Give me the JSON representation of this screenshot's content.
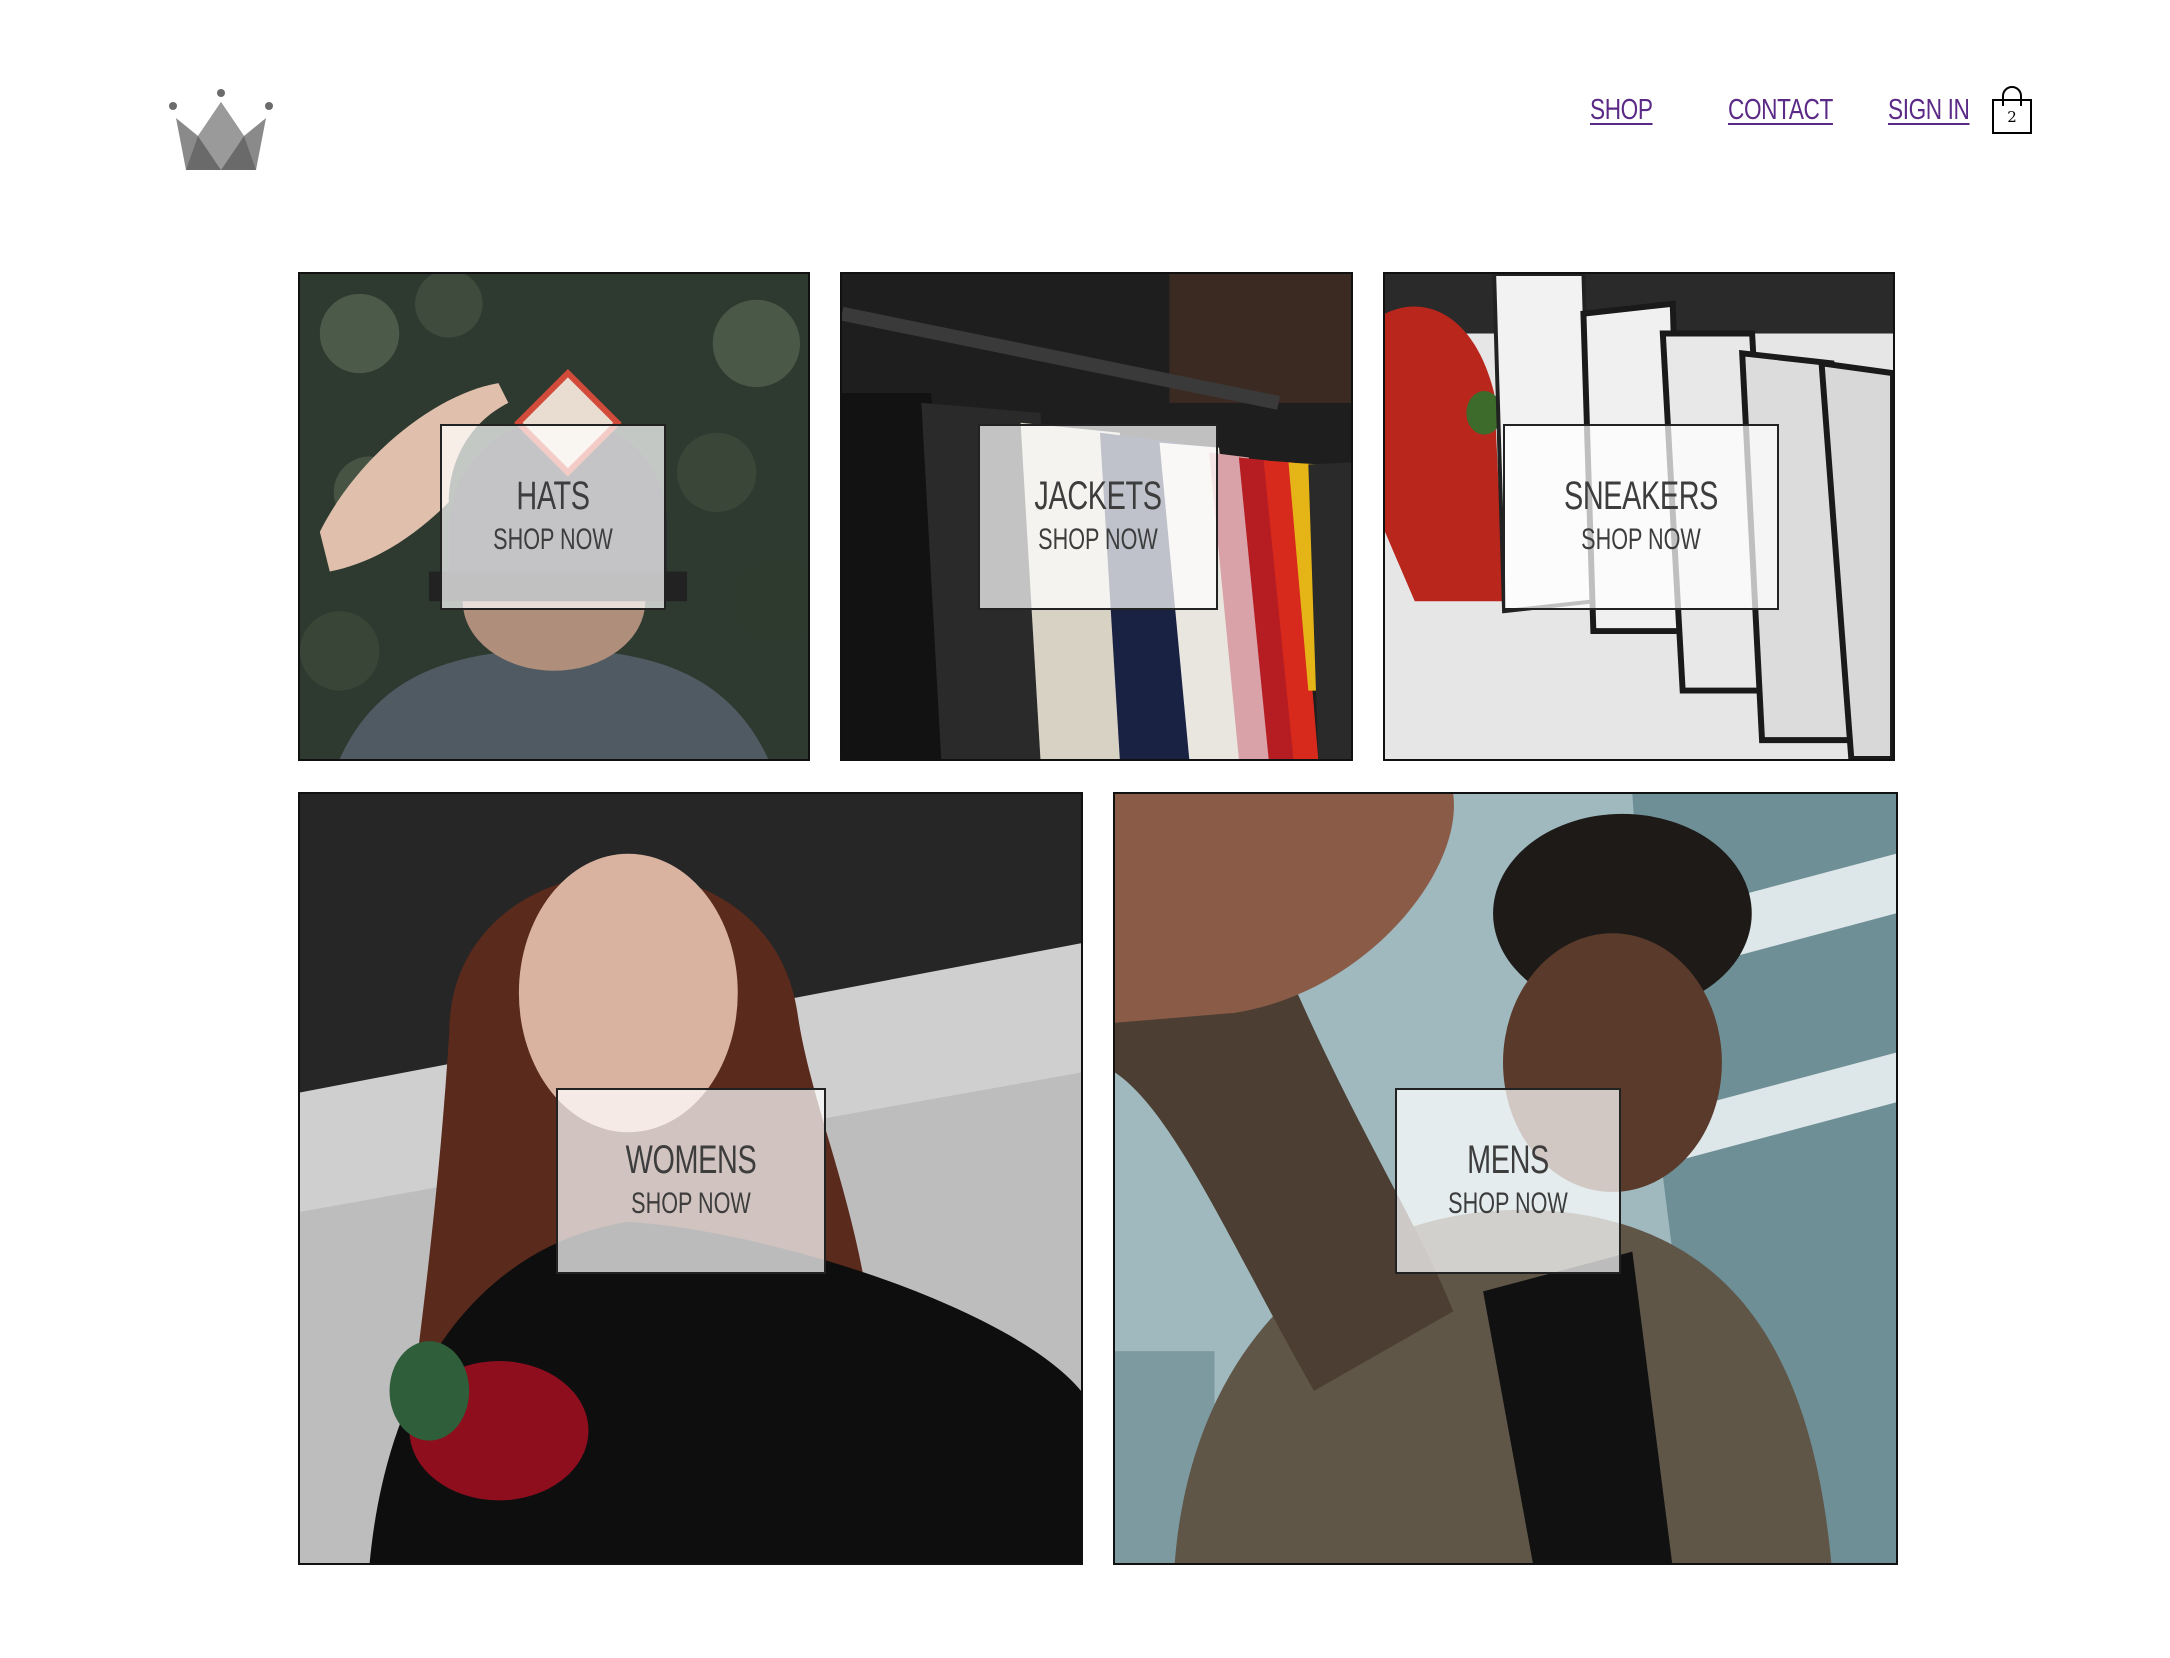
{
  "header": {
    "nav": [
      {
        "label": "SHOP"
      },
      {
        "label": "CONTACT"
      },
      {
        "label": "SIGN IN"
      }
    ],
    "cart_count": "2"
  },
  "colors": {
    "link": "#5b2a86",
    "logo": "#6b6b6b",
    "label_text": "#3d3d3d"
  },
  "categories": [
    {
      "title": "HATS",
      "cta": "SHOP NOW",
      "icon": "hat-photo"
    },
    {
      "title": "JACKETS",
      "cta": "SHOP NOW",
      "icon": "jackets-photo"
    },
    {
      "title": "SNEAKERS",
      "cta": "SHOP NOW",
      "icon": "sneakers-photo"
    },
    {
      "title": "WOMENS",
      "cta": "SHOP NOW",
      "icon": "womens-photo"
    },
    {
      "title": "MENS",
      "cta": "SHOP NOW",
      "icon": "mens-photo"
    }
  ]
}
